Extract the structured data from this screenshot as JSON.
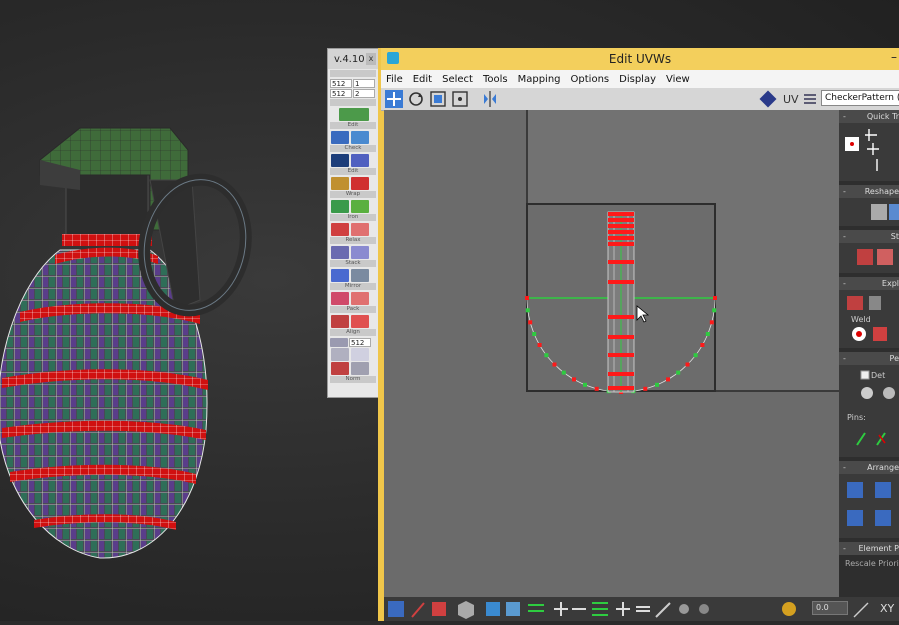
{
  "tool_panel": {
    "version": "v.4.10",
    "close": "x",
    "size_rows": [
      {
        "value": "512",
        "count": "1"
      },
      {
        "value": "512",
        "count": "2"
      }
    ],
    "zoom_value": "512",
    "sections": [
      "Edit",
      "Check",
      "Edit",
      "Wrap",
      "Iron",
      "Relax",
      "Stack",
      "Mirror",
      "Pack",
      "Align",
      "Norm"
    ]
  },
  "uv_window": {
    "title": "Edit UVWs",
    "minimize": "–",
    "menu": [
      "File",
      "Edit",
      "Select",
      "Tools",
      "Mapping",
      "Options",
      "Display",
      "View"
    ],
    "uv_label": "UV",
    "texture_dropdown": "CheckerPattern  ( Checker )",
    "right_panel": {
      "sections": [
        {
          "title": "Quick Tr",
          "symbol": "-"
        },
        {
          "title": "Reshape",
          "symbol": "-"
        },
        {
          "title": "St",
          "symbol": "-"
        },
        {
          "title": "Expl",
          "symbol": "-"
        },
        {
          "title": "Pe",
          "symbol": "-"
        },
        {
          "title": "Arrange",
          "symbol": "-"
        },
        {
          "title": "Element P",
          "symbol": "-"
        }
      ],
      "weld_label": "Weld",
      "det_label": "Det",
      "pins_label": "Pins:",
      "rescale_label": "Rescale Priorit"
    },
    "status": {
      "zoom_value": "0.0",
      "xy_label": "XY"
    }
  },
  "colors": {
    "window_accent": "#f0c64a",
    "uv_canvas": "#6a6a6a",
    "selected_edges": "#ff1a1a",
    "seam": "#2ecc40"
  }
}
